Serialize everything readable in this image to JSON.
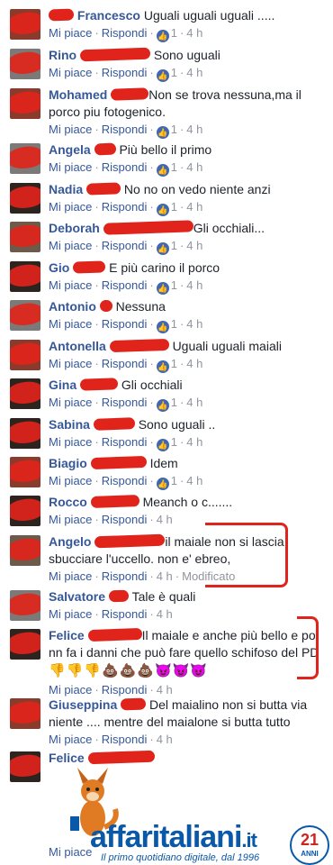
{
  "actions": {
    "like": "Mi piace",
    "reply": "Rispondi",
    "separator": "·",
    "edited": "Modificato"
  },
  "comments": [
    {
      "name": "Francesco",
      "text": "Uguali uguali uguali .....",
      "likes": "1",
      "time": "4 h"
    },
    {
      "name": "Rino",
      "text": "Sono uguali",
      "likes": "1",
      "time": "4 h"
    },
    {
      "name": "Mohamed",
      "text": "Non se trova nessuna,ma il porco piu fotogenico.",
      "likes": "1",
      "time": "4 h"
    },
    {
      "name": "Angela",
      "text": "Più bello il primo",
      "likes": "1",
      "time": "4 h"
    },
    {
      "name": "Nadia",
      "text": "No no on vedo niente anzi",
      "likes": "1",
      "time": "4 h"
    },
    {
      "name": "Deborah",
      "text": "Gli occhiali...",
      "likes": "1",
      "time": "4 h"
    },
    {
      "name": "Gio",
      "text": "E più carino il porco",
      "likes": "1",
      "time": "4 h"
    },
    {
      "name": "Antonio",
      "text": "Nessuna",
      "likes": "1",
      "time": "4 h"
    },
    {
      "name": "Antonella",
      "text": "Uguali uguali maiali",
      "likes": "1",
      "time": "4 h"
    },
    {
      "name": "Gina",
      "text": "Gli occhiali",
      "likes": "1",
      "time": "4 h"
    },
    {
      "name": "Sabina",
      "text": "Sono uguali ..",
      "likes": "1",
      "time": "4 h"
    },
    {
      "name": "Biagio",
      "text": "Idem",
      "likes": "1",
      "time": "4 h"
    },
    {
      "name": "Rocco",
      "text": "Meanch o c.......",
      "time": "4 h"
    },
    {
      "name": "Angelo",
      "text": "il maiale non si lascia sbucciare l'uccello. non e' ebreo,",
      "time": "4 h",
      "edited": true
    },
    {
      "name": "Salvatore",
      "text": "Tale è quali",
      "time": "4 h"
    },
    {
      "name": "Felice",
      "text": "Il maiale e anche più bello e poi nn fa i danni che può fare quello schifoso del PD",
      "time": "4 h"
    },
    {
      "name": "Giuseppina",
      "text": "Del maialino non si butta via niente .... mentre del maialone si butta tutto",
      "time": "4 h"
    },
    {
      "name": "Felice",
      "text": ""
    }
  ],
  "felice_emojis": {
    "hands": "👎👎👎",
    "poo": "💩💩💩",
    "devils": "😈😈😈"
  },
  "last_meta": {
    "like": "Mi piace"
  },
  "watermark": {
    "brand": "affaritaliani",
    "tld": ".it",
    "tagline": "Il primo quotidiano digitale, dal 1996",
    "badge_number": "21",
    "badge_label": "ANNI"
  }
}
